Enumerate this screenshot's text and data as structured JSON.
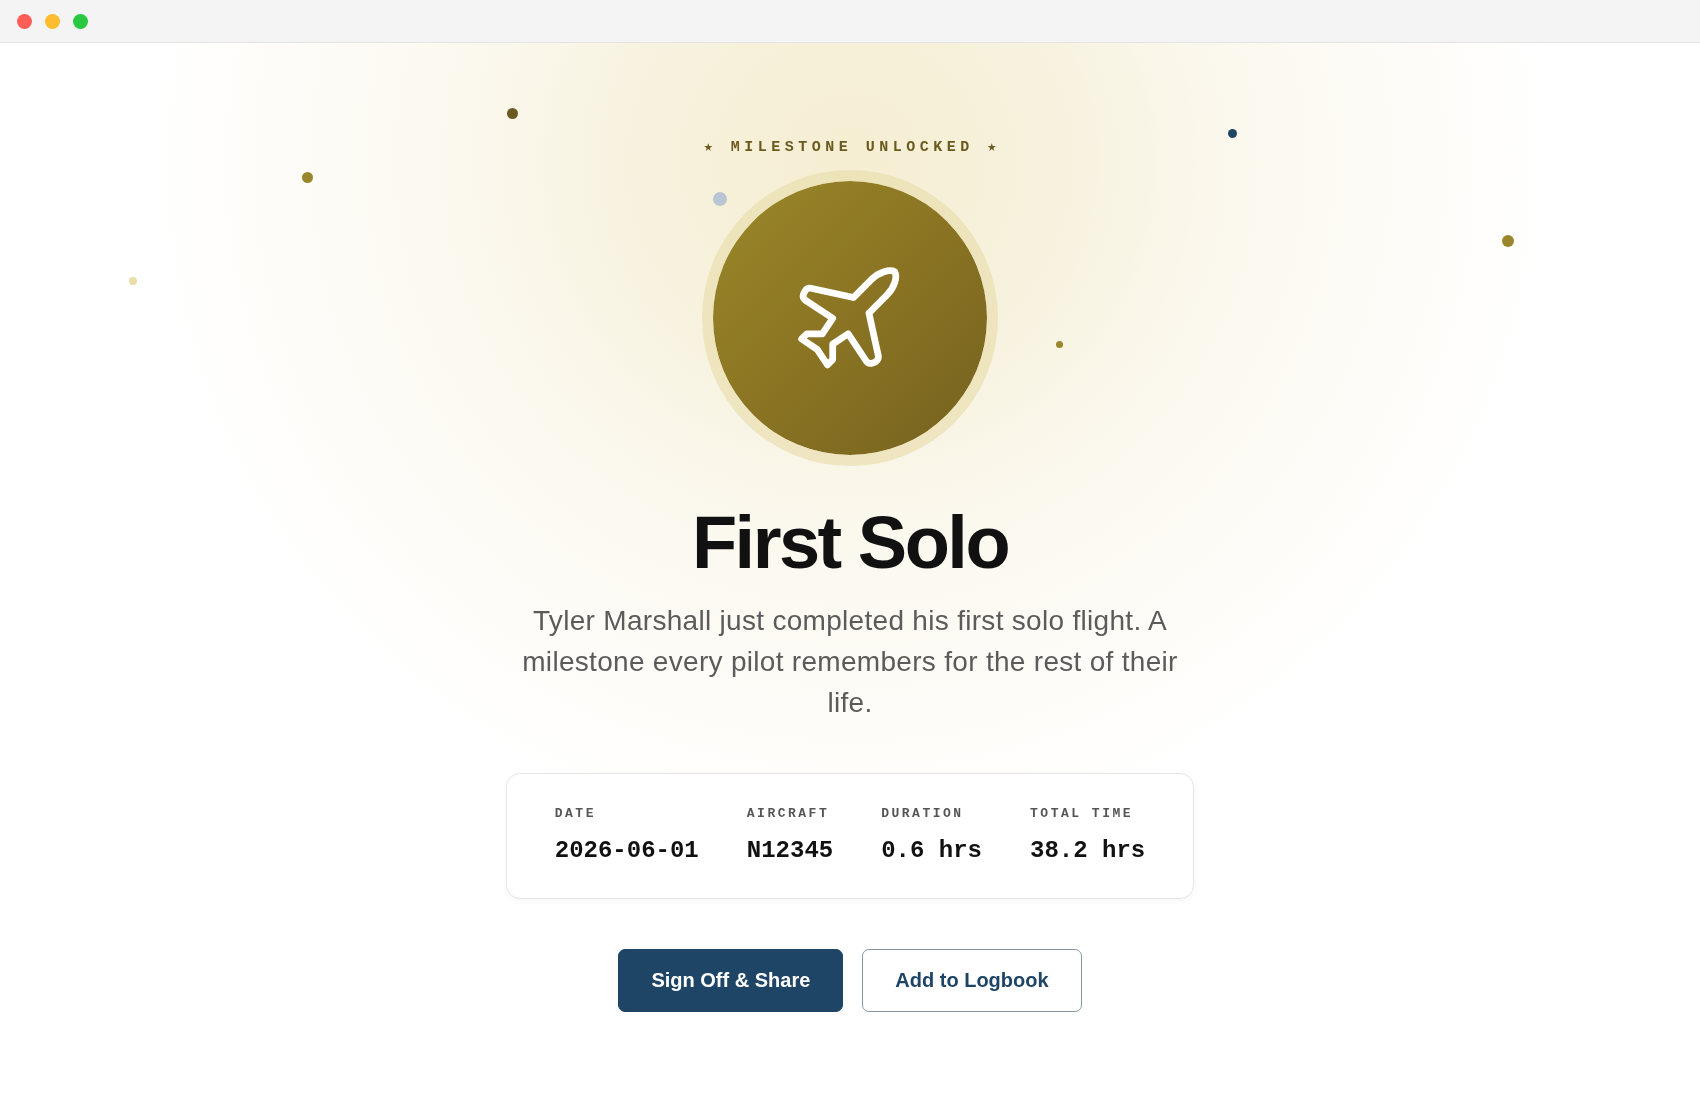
{
  "badge": {
    "eyebrow": "★ MILESTONE UNLOCKED ★"
  },
  "title": "First Solo",
  "description": "Tyler Marshall just completed his first solo flight. A milestone every pilot remembers for the rest of their life.",
  "stats": [
    {
      "label": "DATE",
      "value": "2026-06-01"
    },
    {
      "label": "AIRCRAFT",
      "value": "N12345"
    },
    {
      "label": "DURATION",
      "value": "0.6 hrs"
    },
    {
      "label": "TOTAL TIME",
      "value": "38.2 hrs"
    }
  ],
  "actions": [
    {
      "label": "Sign Off & Share",
      "kind": "primary"
    },
    {
      "label": "Add to Logbook",
      "kind": "secondary"
    }
  ],
  "confetti": [
    {
      "color": "#6b5a1f"
    },
    {
      "color": "#1f4566"
    },
    {
      "color": "#9a862b"
    },
    {
      "color": "#b9c5d2"
    },
    {
      "color": "#9a862b"
    },
    {
      "color": "#e8dea6"
    },
    {
      "color": "#9a862b"
    }
  ]
}
